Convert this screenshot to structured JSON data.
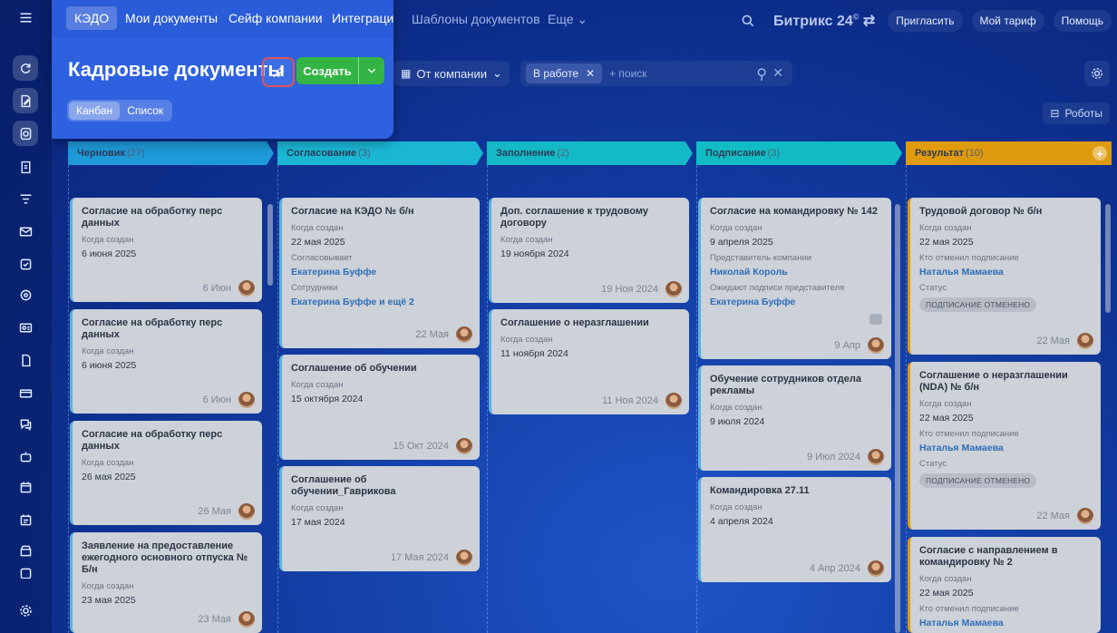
{
  "top_nav": {
    "hidden_tabs": [
      "Шаблоны документов",
      "Еще"
    ],
    "brand": "Битрикс 24",
    "invite": "Пригласить",
    "tariff": "Мой тариф",
    "help": "Помощь"
  },
  "popup": {
    "tabs": [
      "КЭДО",
      "Мои документы",
      "Сейф компании",
      "Интеграции"
    ],
    "title": "Кадровые документы",
    "create": "Создать",
    "views": [
      "Канбан",
      "Список"
    ]
  },
  "filters": {
    "company": "От компании",
    "chip": "В работе",
    "search_placeholder": "+ поиск"
  },
  "robots": "Роботы",
  "columns": [
    {
      "name": "Черновик",
      "count": "(27)",
      "color": "#1e9ad8"
    },
    {
      "name": "Согласование",
      "count": "(3)",
      "color": "#1ab7d4"
    },
    {
      "name": "Заполнение",
      "count": "(2)",
      "color": "#13b9c6"
    },
    {
      "name": "Подписание",
      "count": "(3)",
      "color": "#12bcc4"
    },
    {
      "name": "Результат",
      "count": "(10)",
      "color": "#e09a0d"
    }
  ],
  "cards": {
    "c1_1": {
      "title": "Согласие на обработку перс данных",
      "label": "Когда создан",
      "value": "6 июня 2025",
      "date": "6 Июн"
    },
    "c1_2": {
      "title": "Согласие на обработку перс данных",
      "label": "Когда создан",
      "value": "6 июня 2025",
      "date": "6 Июн"
    },
    "c1_3": {
      "title": "Согласие на обработку перс данных",
      "label": "Когда создан",
      "value": "26 мая 2025",
      "date": "26 Мая"
    },
    "c1_4": {
      "title": "Заявление на предоставление ежегодного основного отпуска № Б/н",
      "label": "Когда создан",
      "value": "23 мая 2025",
      "date": "23 Мая"
    },
    "c2_1": {
      "title": "Согласие на КЭДО № б/н",
      "label": "Когда создан",
      "value": "22 мая 2025",
      "label2": "Согласовывает",
      "value2": "Екатерина Буффе",
      "label3": "Сотрудники",
      "value3": "Екатерина Буффе и ещё 2",
      "date": "22 Мая"
    },
    "c2_2": {
      "title": "Соглашение об обучении",
      "label": "Когда создан",
      "value": "15 октября 2024",
      "date": "15 Окт 2024"
    },
    "c2_3": {
      "title": "Соглашение об обучении_Гаврикова",
      "label": "Когда создан",
      "value": "17 мая 2024",
      "date": "17 Мая 2024"
    },
    "c3_1": {
      "title": "Доп. соглашение к трудовому договору",
      "label": "Когда создан",
      "value": "19 ноября 2024",
      "date": "19 Ноя 2024"
    },
    "c3_2": {
      "title": "Соглашение о неразглашении",
      "label": "Когда создан",
      "value": "11 ноября 2024",
      "date": "11 Ноя 2024"
    },
    "c4_1": {
      "title": "Согласие на командировку № 142",
      "label": "Когда создан",
      "value": "9 апреля 2025",
      "label2": "Представитель компании",
      "value2": "Николай Король",
      "label3": "Ожидают подписи представителя",
      "value3": "Екатерина Буффе",
      "date": "9 Апр"
    },
    "c4_2": {
      "title": "Обучение сотрудников отдела рекламы",
      "label": "Когда создан",
      "value": "9 июля 2024",
      "date": "9 Июл 2024"
    },
    "c4_3": {
      "title": "Командировка 27.11",
      "label": "Когда создан",
      "value": "4 апреля 2024",
      "date": "4 Апр 2024"
    },
    "c5_1": {
      "title": "Трудовой договор № б/н",
      "label": "Когда создан",
      "value": "22 мая 2025",
      "label2": "Кто отменил подписание",
      "value2": "Наталья Мамаева",
      "label3": "Статус",
      "badge": "ПОДПИСАНИЕ ОТМЕНЕНО",
      "date": "22 Мая"
    },
    "c5_2": {
      "title": "Соглашение о неразглашении (NDA) № б/н",
      "label": "Когда создан",
      "value": "22 мая 2025",
      "label2": "Кто отменил подписание",
      "value2": "Наталья Мамаева",
      "label3": "Статус",
      "badge": "ПОДПИСАНИЕ ОТМЕНЕНО",
      "date": "22 Мая"
    },
    "c5_3": {
      "title": "Согласие с направлением в командировку № 2",
      "label": "Когда создан",
      "value": "22 мая 2025",
      "label2": "Кто отменил подписание",
      "value2": "Наталья Мамаева"
    }
  }
}
